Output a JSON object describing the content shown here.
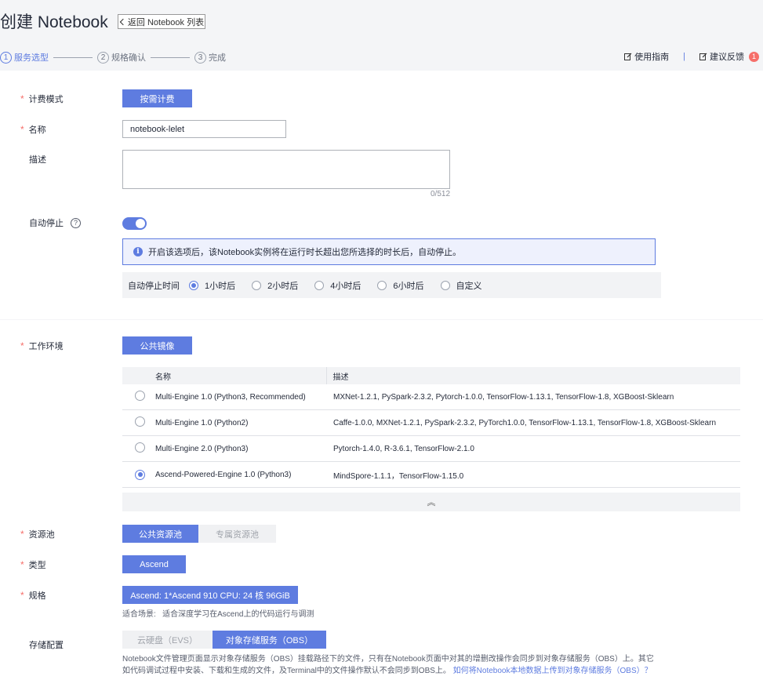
{
  "header": {
    "title": "创建 Notebook",
    "back_label": "返回 Notebook 列表",
    "steps": [
      {
        "num": "1",
        "label": "服务选型"
      },
      {
        "num": "2",
        "label": "规格确认"
      },
      {
        "num": "3",
        "label": "完成"
      }
    ],
    "guide_label": "使用指南",
    "feedback_label": "建议反馈",
    "feedback_count": "1"
  },
  "form": {
    "billing": {
      "label": "计费模式",
      "value": "按需计费"
    },
    "name": {
      "label": "名称",
      "value": "notebook-lelet"
    },
    "description": {
      "label": "描述",
      "value": "",
      "counter": "0/512"
    },
    "auto_stop": {
      "label": "自动停止",
      "help_icon": "?",
      "enabled": true,
      "info_icon": "i",
      "info_text": "开启该选项后，该Notebook实例将在运行时长超出您所选择的时长后，自动停止。",
      "time_label": "自动停止时间",
      "options": [
        "1小时后",
        "2小时后",
        "4小时后",
        "6小时后",
        "自定义"
      ],
      "selected": "1小时后"
    },
    "work_env": {
      "label": "工作环境",
      "tab": "公共镜像",
      "columns": [
        "名称",
        "描述"
      ],
      "rows": [
        {
          "name": "Multi-Engine 1.0 (Python3, Recommended)",
          "desc": "MXNet-1.2.1, PySpark-2.3.2, Pytorch-1.0.0, TensorFlow-1.13.1, TensorFlow-1.8, XGBoost-Sklearn",
          "selected": false
        },
        {
          "name": "Multi-Engine 1.0 (Python2)",
          "desc": "Caffe-1.0.0, MXNet-1.2.1, PySpark-2.3.2, PyTorch1.0.0, TensorFlow-1.13.1, TensorFlow-1.8, XGBoost-Sklearn",
          "selected": false
        },
        {
          "name": "Multi-Engine 2.0 (Python3)",
          "desc": "Pytorch-1.4.0, R-3.6.1, TensorFlow-2.1.0",
          "selected": false
        },
        {
          "name": "Ascend-Powered-Engine 1.0 (Python3)",
          "desc": "MindSpore-1.1.1，TensorFlow-1.15.0",
          "selected": true
        }
      ],
      "collapse_icon": "︽"
    },
    "pool": {
      "label": "资源池",
      "options": [
        "公共资源池",
        "专属资源池"
      ],
      "selected": "公共资源池"
    },
    "type": {
      "label": "类型",
      "value": "Ascend"
    },
    "spec": {
      "label": "规格",
      "value": "Ascend: 1*Ascend 910 CPU: 24 核 96GiB",
      "scene_label": "适合场景:",
      "scene_text": "适合深度学习在Ascend上的代码运行与调测"
    },
    "storage": {
      "label": "存储配置",
      "options": [
        "云硬盘（EVS）",
        "对象存储服务（OBS）"
      ],
      "selected": "对象存储服务（OBS）",
      "hint_line1": "Notebook文件管理页面显示对象存储服务（OBS）挂载路径下的文件，只有在Notebook页面中对其的增删改操作会同步到对象存储服务（OBS）上。其它",
      "hint_line2": "如代码调试过程中安装、下载和生成的文件，及Terminal中的文件操作默认不会同步到OBS上。",
      "hint_link": "如何将Notebook本地数据上传到对象存储服务（OBS）？"
    }
  },
  "colors": {
    "primary": "#5e7ce0",
    "required": "#f66f6a",
    "badge": "#f66f6a"
  }
}
